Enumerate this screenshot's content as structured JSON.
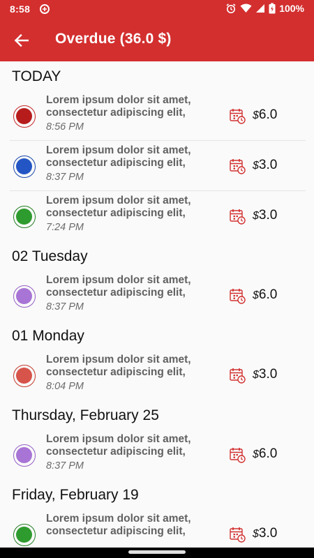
{
  "status_bar": {
    "time": "8:58",
    "battery": "100%"
  },
  "app_bar": {
    "title": "Overdue (36.0 $)"
  },
  "colors": {
    "primary": "#d32f2f"
  },
  "sections": [
    {
      "header": "TODAY",
      "items": [
        {
          "title_line1": "Lorem ipsum dolor sit amet,",
          "title_line2": "consectetur adipiscing elit,",
          "time": "8:56 PM",
          "currency": "$",
          "amount": "6.0",
          "color": "#b71c1c",
          "ring": "#c62828"
        },
        {
          "title_line1": "Lorem ipsum dolor sit amet,",
          "title_line2": "consectetur adipiscing elit,",
          "time": "8:37 PM",
          "currency": "$",
          "amount": "3.0",
          "color": "#2356c4",
          "ring": "#1a47a8"
        },
        {
          "title_line1": "Lorem ipsum dolor sit amet,",
          "title_line2": "consectetur adipiscing elit,",
          "time": "7:24 PM",
          "currency": "$",
          "amount": "3.0",
          "color": "#2e9b2e",
          "ring": "#237d23"
        }
      ]
    },
    {
      "header": "02 Tuesday",
      "items": [
        {
          "title_line1": "Lorem ipsum dolor sit amet,",
          "title_line2": "consectetur adipiscing elit,",
          "time": "8:37 PM",
          "currency": "$",
          "amount": "6.0",
          "color": "#a874d6",
          "ring": "#9560c4"
        }
      ]
    },
    {
      "header": "01 Monday",
      "items": [
        {
          "title_line1": "Lorem ipsum dolor sit amet,",
          "title_line2": "consectetur adipiscing elit,",
          "time": "8:04 PM",
          "currency": "$",
          "amount": "3.0",
          "color": "#d6544a",
          "ring": "#c0392b"
        }
      ]
    },
    {
      "header": "Thursday, February 25",
      "items": [
        {
          "title_line1": "Lorem ipsum dolor sit amet,",
          "title_line2": "consectetur adipiscing elit,",
          "time": "8:37 PM",
          "currency": "$",
          "amount": "6.0",
          "color": "#a874d6",
          "ring": "#9560c4"
        }
      ]
    },
    {
      "header": "Friday, February 19",
      "items": [
        {
          "title_line1": "Lorem ipsum dolor sit amet,",
          "title_line2": "consectetur adipiscing elit,",
          "time": "",
          "currency": "$",
          "amount": "3.0",
          "color": "#2e9b2e",
          "ring": "#237d23"
        }
      ]
    }
  ]
}
